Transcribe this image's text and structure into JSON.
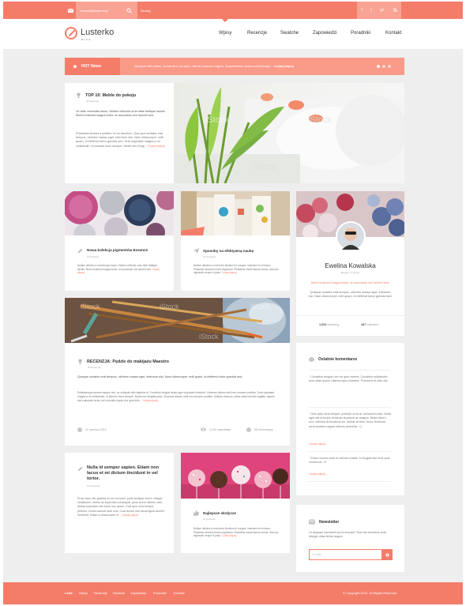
{
  "topbar": {
    "email": "kontakt@lusterko.pl",
    "search_placeholder": "Szukaj...",
    "social": [
      "f",
      "t",
      "g+",
      "rss"
    ]
  },
  "header": {
    "logo_title": "Lusterko",
    "logo_sub": "BLOG",
    "nav": [
      "Wpisy",
      "Recenzje",
      "Swatche",
      "Zapowiedzi",
      "Poradniki",
      "Kontakt"
    ]
  },
  "hot": {
    "label": "HOT News",
    "text": "Quisque nibh tellus, hendrerit a dui quis, rutrum rhoncus magna. Suspendisse viverra scelerisque...",
    "more": "Czytaj więcej"
  },
  "featured": {
    "title": "TOP 10: Meble do pokoju",
    "meta": "W Recenzje",
    "lead": "Ut vitae venenatis lacus. Nullam vehicula urna vitae tristique iaculis. Morbi euismod magna tortor, at accumsan orci laoreet sed.",
    "body": "Phasellus tincidunt porttitor mi eu faucibus. Quis que sodales erat tempus, ultricies massa eget, interdum nisi. Nam ullamcorper velit quam, id eleifend tortor gravida sed. Duis vulputate magna a mi sollicitudin, id lobortis risus semper. Morbi nec fringi...",
    "more": "Czytaj więcej",
    "watermark": "iStock"
  },
  "pigments": {
    "title": "Nowa kolekcja pigmentów Essence",
    "meta": "W Swatche",
    "text": "Nullam ultricies a erat tempor lacus. Nullam vehicula urna vitae tristique iaculis. Morbi euismod magna tortor, at accumsan orci laoreet sed.",
    "more": "Czytaj więcej"
  },
  "sposoby": {
    "title": "Sposoby na efektywną naukę",
    "meta": "W Poradniki",
    "text": "Nullam ultricies a erat tortor tincidunt id congue. Interdum et mi lacus. Phasellus tincidunt lorem dignissim. Phasellus eisuid lacuse metus, rhoncus dignissim neque in justo.",
    "more": "Czytaj więcej"
  },
  "profile": {
    "name": "Ewelina Kowalska",
    "role": "Blogger, Youtuber",
    "quote": "Morbi euismod magna tortor, at accumsan orci laoreet sed.",
    "text": "Quisque sodales erat tempus, ultricies massa eget, interdum nisi. Nam ullamcorper velit quam, id eleifend tortor gravida sed.",
    "following_count": "1,000",
    "following_label": "following",
    "followers_count": "287",
    "followers_label": "followers"
  },
  "review": {
    "title": "RECENZJA: Pędzle do makijażu Maestro",
    "meta": "W Recenzje",
    "lead": "Quisque sodales erat tempus, ultricies massa eget, interdum nisi. Nam ullamcorper velit quam, id eleifend tortor gravida sed.",
    "body": "Pellentesque laoreet sapien nisi, ac volutpat nibh dapibus id. Curabitur feugiat turpis eget vulputate tincidunt. Vivamus dictum velit non semper porttitor. Duis vulputate magna a mi sollicitudin, id lobortis risus semper. Morbi nec fringilla justo. Vivamus dictum velit non semper porttitor. Nullam rhoncus, tellus vitae lobortis sagittis, sapien nisl vulputate tortor, vel convallis turpis orci quis felis...",
    "more": "Czytaj więcej",
    "date": "11 czerwca 2014",
    "views": "3,200 wyświetleń",
    "comments": "98 komentarzy",
    "watermark": "iStock"
  },
  "comments_widget": {
    "title": "Ostatnie komentarze",
    "items": [
      {
        "text": "Curabitur feugiat non mi quis viverra. Curabitur sollicitudin sem vitae ipsum ullamcorper pharetra. Praesent et odio dui.",
        "more": ""
      },
      {
        "text": "Duis quis urna tempor, pretium urna at, euismod tortor. Nulla eget elit id turpis vehicula tincidunt ac magna. Etiam libero orci, ultricies at faucibus eu, lacinia at felis. Nunc tincidunt urna laoreet magna ultrices pharetra. =)",
        "more": "Czytaj więcej..."
      },
      {
        "text": "Etiam viverra ante et ultrices mattis. In feugiat nisl eros quis commodo. !!!",
        "more": "Czytaj więcej..."
      }
    ]
  },
  "nulla": {
    "title": "Nulla id semper sapien. Etiam non lacus et mi dictum tincidunt in vel tortor.",
    "meta": "W Poradniki",
    "text": "Proin risus elit, gravida eu leo sit amet, porta tristique lorem. Integer vestibulum, metus ac imperdiet consequat, justo lorem ultrices nibh, lacinia imperdiet nisl turpis non quam. Duis quis urna tempor, pretium. Donec laoreet ante erat. Cras auctor non lacus ligula laoreet hendrerit. Etiam a ullamcorper m...",
    "more": "Czytaj więcej"
  },
  "slodycze": {
    "title": "Najlepsze słodycze",
    "meta": "W Jedzenie",
    "text": "Nullam ultricies a erat tortor tincidunt id congue. Interdum et mi lacus. Phasellus tincidunt lorem dignissim. Phasellus eisuid lacuse metus, rhoncus dignissim neque in justo.",
    "more": "Czytaj więcej"
  },
  "newsletter": {
    "title": "Newsletter",
    "text": "Ut aliquam hendrerit dui id suscipit. Sed non tincidunt ante. Integer vitae tellus augue.",
    "placeholder": "E-mail..."
  },
  "footer": {
    "links_label": "Linki:",
    "links": [
      "Wpisy",
      "Recenzje",
      "Swatche",
      "Zapowiedzi",
      "Poradniki",
      "Kontakt"
    ],
    "copyright": "© Copyright 2015. All Rights Reserved"
  },
  "colors": {
    "accent": "#f47d6a",
    "accent_light": "#fa9a89",
    "page_bg": "#eeeeee"
  },
  "icons": [
    "mail-icon",
    "search-icon",
    "facebook-icon",
    "twitter-icon",
    "google-plus-icon",
    "rss-icon",
    "trophy-icon",
    "pencil-icon",
    "paper-plane-icon",
    "thumbs-up-icon",
    "comment-icon",
    "calendar-icon",
    "eye-icon",
    "envelope-icon",
    "arrow-icon"
  ]
}
